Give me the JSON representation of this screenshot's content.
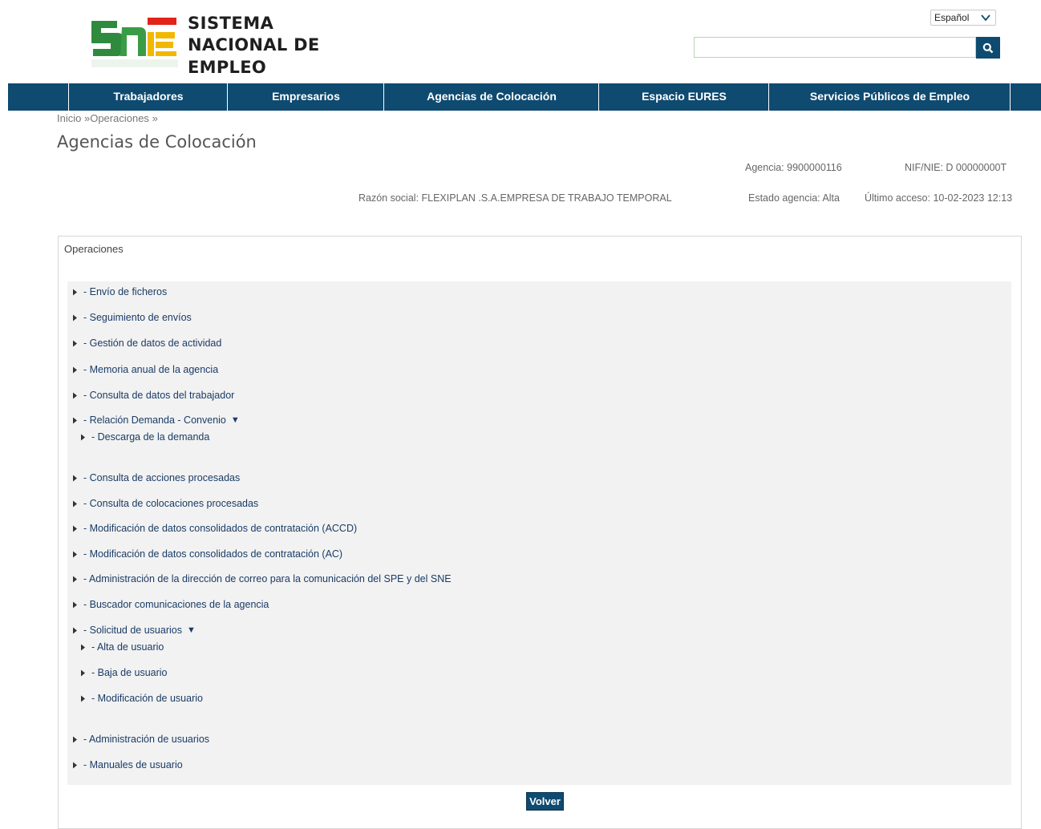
{
  "logo": {
    "line1": "SISTEMA",
    "line2": "NACIONAL DE EMPLEO",
    "colors": {
      "green": "#2e8b3e",
      "red": "#e2231a",
      "yellow": "#f2b800"
    }
  },
  "language": {
    "selected": "Español",
    "icon": "chevron-down-icon"
  },
  "search": {
    "value": "",
    "placeholder": "",
    "icon": "search-icon"
  },
  "nav": {
    "items": [
      {
        "label": "Trabajadores"
      },
      {
        "label": "Empresarios"
      },
      {
        "label": "Agencias de Colocación"
      },
      {
        "label": "Espacio EURES"
      },
      {
        "label": "Servicios Públicos de Empleo"
      }
    ],
    "color": "#0f4a70"
  },
  "breadcrumb": {
    "home": "Inicio",
    "sep1": "»",
    "current": "Operaciones",
    "sep2": "»"
  },
  "page": {
    "title": "Agencias de Colocación"
  },
  "agency": {
    "agencia": "Agencia: 9900000116",
    "nif": "NIF/NIE: D 00000000T",
    "razon": "Razón social: FLEXIPLAN .S.A.EMPRESA DE TRABAJO TEMPORAL",
    "estado": "Estado agencia: Alta",
    "ultimo": "Último acceso: 10-02-2023 12:13"
  },
  "operations": {
    "title": "Operaciones",
    "items": [
      {
        "label": "- Envío de ficheros"
      },
      {
        "label": "- Seguimiento de envíos"
      },
      {
        "label": "- Gestión de datos de actividad"
      },
      {
        "label": "- Memoria anual de la agencia"
      },
      {
        "label": "- Consulta de datos del trabajador"
      },
      {
        "label": "- Relación Demanda - Convenio",
        "expand": "▼"
      },
      {
        "label": "- Descarga de la demanda"
      },
      {
        "label": "- Consulta de acciones procesadas"
      },
      {
        "label": "- Consulta de colocaciones procesadas"
      },
      {
        "label": "- Modificación de datos consolidados de contratación (ACCD)"
      },
      {
        "label": "- Modificación de datos consolidados de contratación (AC)"
      },
      {
        "label": "- Administración de la dirección de correo para la comunicación del SPE y del SNE"
      },
      {
        "label": "- Buscador comunicaciones de la agencia"
      },
      {
        "label": "- Solicitud de usuarios",
        "expand": "▼"
      },
      {
        "label": "- Alta de usuario"
      },
      {
        "label": "- Baja de usuario"
      },
      {
        "label": "- Modificación de usuario"
      },
      {
        "label": "- Administración de usuarios"
      },
      {
        "label": "- Manuales de usuario"
      }
    ],
    "back_label": "Volver"
  }
}
